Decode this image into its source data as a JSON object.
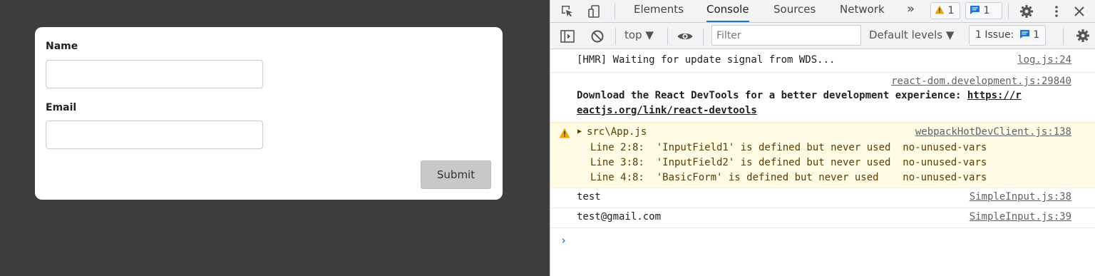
{
  "form": {
    "name_label": "Name",
    "name_value": "",
    "email_label": "Email",
    "email_value": "",
    "submit_label": "Submit"
  },
  "devtools": {
    "tabs": [
      "Elements",
      "Console",
      "Sources",
      "Network"
    ],
    "more_tabs": "»",
    "warning_count": "1",
    "message_count": "1",
    "context": "top ▼",
    "filter_placeholder": "Filter",
    "levels": "Default levels ▼",
    "issues_label": "1 Issue:",
    "issues_count": "1",
    "colors": {
      "accent": "#1a73e8",
      "warning_bg": "#fffbe5",
      "warning_icon": "#f2a600"
    }
  },
  "console": {
    "entries": [
      {
        "text": "[HMR] Waiting for update signal from WDS...",
        "source": "log.js:24"
      },
      {
        "source": "react-dom.development.js:29840",
        "text_line1": "Download the React DevTools for a better development experience: ",
        "link_part1": "https://r",
        "link_part2": "eactjs.org/link/react-devtools"
      },
      {
        "header": "src\\App.js",
        "source": "webpackHotDevClient.js:138",
        "lines": [
          "Line 2:8:  'InputField1' is defined but never used  no-unused-vars",
          "Line 3:8:  'InputField2' is defined but never used  no-unused-vars",
          "Line 4:8:  'BasicForm' is defined but never used    no-unused-vars"
        ]
      },
      {
        "text": "test",
        "source": "SimpleInput.js:38"
      },
      {
        "text": "test@gmail.com",
        "source": "SimpleInput.js:39"
      }
    ],
    "prompt": "›"
  }
}
